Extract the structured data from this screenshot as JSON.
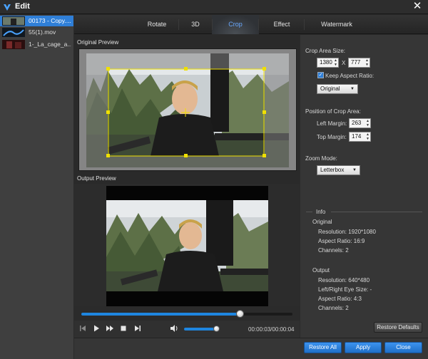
{
  "window": {
    "title": "Edit",
    "close_glyph": "✕"
  },
  "files": [
    {
      "name": "00173 - Copy...."
    },
    {
      "name": "55(1).mov"
    },
    {
      "name": "1-_La_cage_a..."
    }
  ],
  "tabs": [
    "Rotate",
    "3D",
    "Crop",
    "Effect",
    "Watermark"
  ],
  "active_tab": "Crop",
  "preview": {
    "original_label": "Original Preview",
    "output_label": "Output Preview"
  },
  "crop": {
    "area_size_label": "Crop Area Size:",
    "width": "1380",
    "height": "777",
    "x_sep": "X",
    "keep_aspect_label": "Keep Aspect Ratio:",
    "keep_aspect_checked": true,
    "aspect_option": "Original",
    "position_label": "Position of Crop Area:",
    "left_margin_label": "Left Margin:",
    "left_margin": "263",
    "top_margin_label": "Top Margin:",
    "top_margin": "174",
    "zoom_mode_label": "Zoom Mode:",
    "zoom_mode": "Letterbox"
  },
  "info": {
    "title": "Info",
    "original_label": "Original",
    "original_resolution": "Resolution: 1920*1080",
    "original_aspect": "Aspect Ratio: 16:9",
    "original_channels": "Channels: 2",
    "output_label": "Output",
    "output_resolution": "Resolution: 640*480",
    "output_eye": "Left/Right Eye Size: -",
    "output_aspect": "Aspect Ratio: 4:3",
    "output_channels": "Channels: 2"
  },
  "player": {
    "time": "00:00:03/00:00:04",
    "progress": 0.75,
    "volume": 0.92
  },
  "buttons": {
    "restore_defaults": "Restore Defaults",
    "restore_all": "Restore All",
    "apply": "Apply",
    "close": "Close"
  },
  "colors": {
    "accent": "#1f86e0",
    "crop_frame": "#f0e000",
    "active_tab_text": "#69a9ff"
  }
}
